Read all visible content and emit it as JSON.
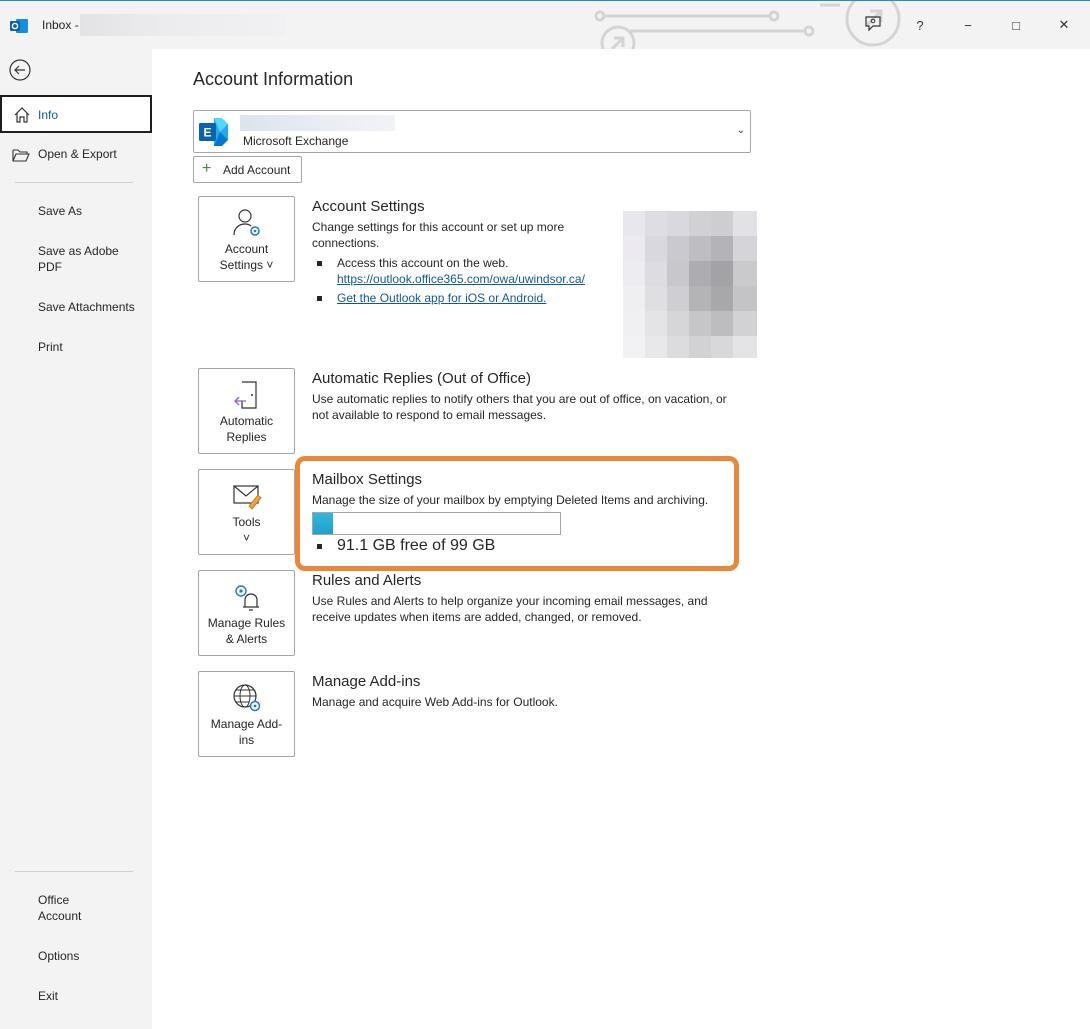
{
  "titlebar": {
    "title": "Inbox -",
    "help_label": "?",
    "minimize_label": "−",
    "maximize_label": "□",
    "close_label": "✕"
  },
  "sidebar": {
    "info_label": "Info",
    "open_export_label": "Open & Export",
    "save_as_label": "Save As",
    "save_adobe_label": "Save as Adobe PDF",
    "save_attachments_label": "Save Attachments",
    "print_label": "Print",
    "office_account_label": "Office Account",
    "options_label": "Options",
    "exit_label": "Exit"
  },
  "main": {
    "page_title": "Account Information",
    "account_type": "Microsoft Exchange",
    "add_account_label": "Add Account",
    "account_settings": {
      "tile_label": "Account Settings ˅",
      "heading": "Account Settings",
      "description": "Change settings for this account or set up more connections.",
      "bullet_access": "Access this account on the web.",
      "web_link": "https://outlook.office365.com/owa/uwindsor.ca/",
      "app_link": "Get the Outlook app for iOS or Android."
    },
    "automatic_replies": {
      "tile_label": "Automatic Replies",
      "heading": "Automatic Replies (Out of Office)",
      "description": "Use automatic replies to notify others that you are out of office, on vacation, or not available to respond to email messages."
    },
    "mailbox": {
      "tile_label": "Tools",
      "tile_chevron": "˅",
      "heading": "Mailbox Settings",
      "description": "Manage the size of your mailbox by emptying Deleted Items and archiving.",
      "usage_fraction": 0.08,
      "quota_text": "91.1 GB free of 99 GB"
    },
    "rules": {
      "tile_label": "Manage Rules & Alerts",
      "heading": "Rules and Alerts",
      "description": "Use Rules and Alerts to help organize your incoming email messages, and receive updates when items are added, changed, or removed."
    },
    "addins": {
      "tile_label": "Manage Add-ins",
      "heading": "Manage Add-ins",
      "description": "Manage and acquire Web Add-ins for Outlook."
    }
  },
  "colors": {
    "accent": "#0f5a9e",
    "highlight": "#e8883a",
    "quota_fill": "#2aaed6"
  }
}
